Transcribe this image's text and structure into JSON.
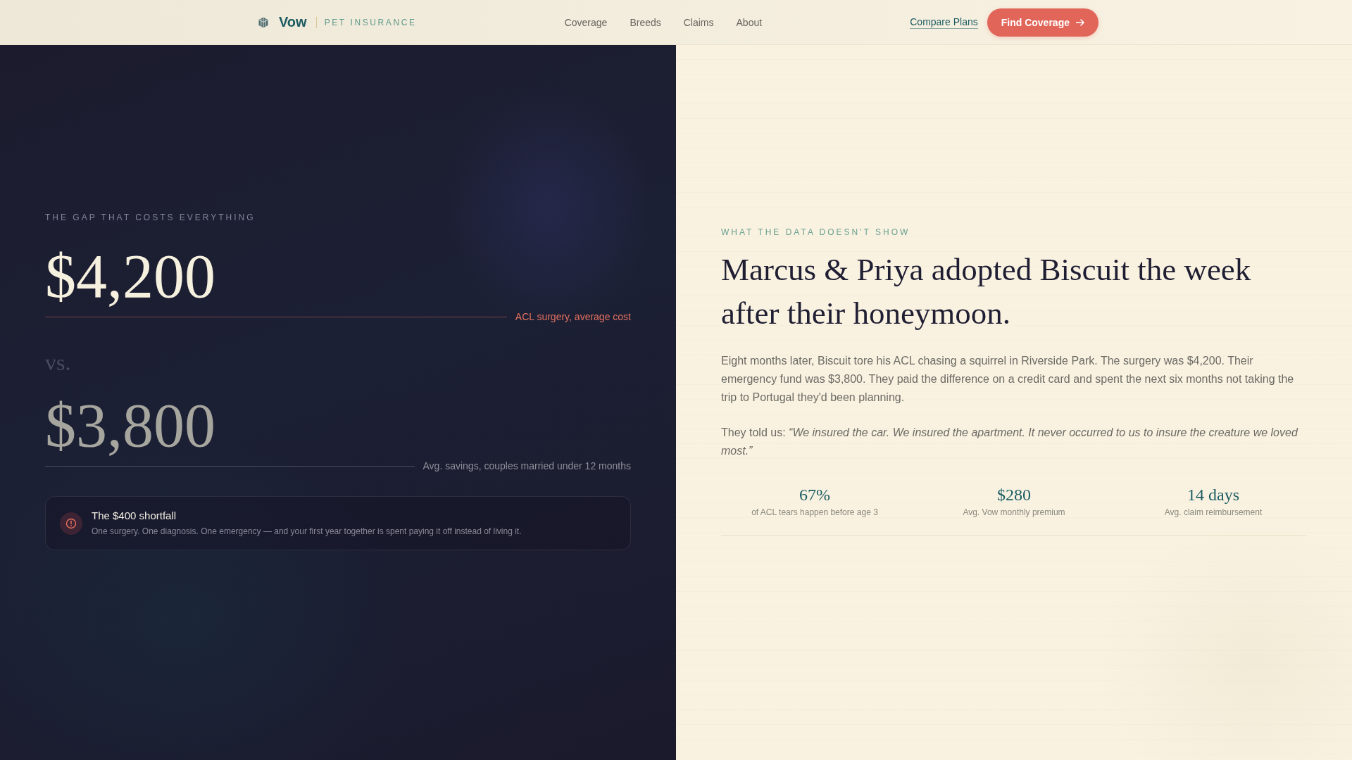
{
  "header": {
    "brand": {
      "name": "Vow",
      "tagline": "PET INSURANCE"
    },
    "nav": [
      "Coverage",
      "Breeds",
      "Claims",
      "About"
    ],
    "link": "Compare Plans",
    "cta": "Find Coverage"
  },
  "comparison": {
    "eyebrow": "THE GAP THAT COSTS EVERYTHING",
    "separator": "vs.",
    "figures": [
      {
        "kind": "cost",
        "amount": "$4,200",
        "caption": "ACL surgery, average cost"
      },
      {
        "kind": "savings",
        "amount": "$3,800",
        "caption": "Avg. savings, couples married under 12 months"
      }
    ],
    "callout": {
      "title": "The $400 shortfall",
      "text": "One surgery. One diagnosis. One emergency — and your first year together is spent paying it off instead of living it."
    }
  },
  "story": {
    "eyebrow": "WHAT THE DATA DOESN'T SHOW",
    "headline": "Marcus & Priya adopted Biscuit the week after their honeymoon.",
    "body": "Eight months later, Biscuit tore his ACL chasing a squirrel in Riverside Park. The surgery was $4,200. Their emergency fund was $3,800. They paid the difference on a credit card and spent the next six months not taking the trip to Portugal they'd been planning.",
    "quote": "They told us: *“We insured the car. We insured the apartment. It never occurred to us to insure the creature we loved most.”*",
    "stats": [
      {
        "value": "67%",
        "label": "of ACL tears happen before age 3"
      },
      {
        "value": "$280",
        "label": "Avg. Vow monthly premium"
      },
      {
        "value": "14 days",
        "label": "Avg. claim reimbursement"
      }
    ]
  }
}
